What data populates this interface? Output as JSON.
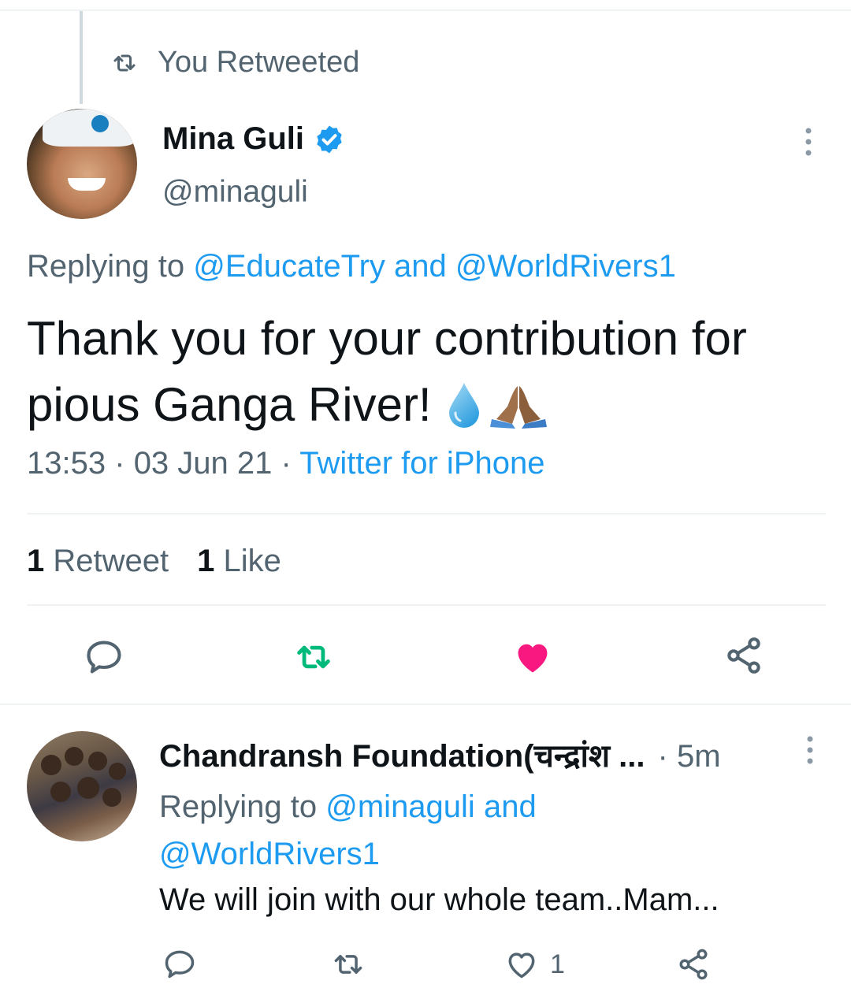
{
  "context": {
    "retweet_label": "You Retweeted"
  },
  "tweet": {
    "author_name": "Mina Guli",
    "handle": "@minaguli",
    "replying_prefix": "Replying to",
    "reply_user_1": "@EducateTry",
    "reply_and": "and",
    "reply_user_2": "@WorldRivers1",
    "text": "Thank you for your contribution for pious Ganga River!",
    "time": "13:53",
    "date": "03 Jun 21",
    "dot": "·",
    "source": "Twitter for iPhone",
    "retweet_count": "1",
    "retweet_label": "Retweet",
    "like_count": "1",
    "like_label": "Like"
  },
  "reply": {
    "author_name": "Chandransh Foundation(चन्द्रांश ...",
    "time": "· 5m",
    "replying_prefix": "Replying to",
    "reply_user_1": "@minaguli",
    "reply_and": "and",
    "reply_user_2": "@WorldRivers1",
    "text": "We will join with our whole team..Mam...",
    "like_count": "1"
  },
  "colors": {
    "accent": "#1d9bf0",
    "retweet_green": "#00ba7c",
    "like_red": "#f91880",
    "secondary_text": "#536471"
  }
}
